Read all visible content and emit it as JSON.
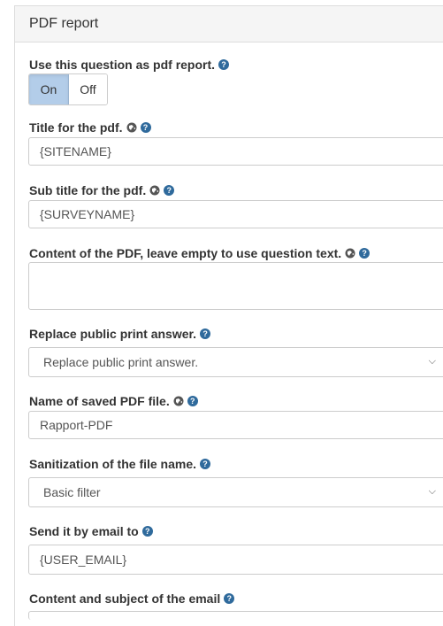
{
  "panel": {
    "title": "PDF report"
  },
  "pdf_report": {
    "label": "Use this question as pdf report.",
    "on_label": "On",
    "off_label": "Off",
    "selected": "On"
  },
  "title_pdf": {
    "label": "Title for the pdf.",
    "value": "{SITENAME}"
  },
  "subtitle_pdf": {
    "label": "Sub title for the pdf.",
    "value": "{SURVEYNAME}"
  },
  "content_pdf": {
    "label": "Content of the PDF, leave empty to use question text.",
    "value": ""
  },
  "replace_print": {
    "label": "Replace public print answer.",
    "selected": "Replace public print answer."
  },
  "file_name": {
    "label": "Name of saved PDF file.",
    "value": "Rapport-PDF"
  },
  "sanitization": {
    "label": "Sanitization of the file name.",
    "selected": "Basic filter"
  },
  "email_to": {
    "label": "Send it by email to",
    "value": "{USER_EMAIL}"
  },
  "email_content": {
    "label": "Content and subject of the email"
  },
  "icons": {
    "help": "question-circle-icon",
    "language": "globe-icon"
  },
  "colors": {
    "accent": "#2f6a9c",
    "toggle_active": "#b3cde9",
    "header_bg": "#f5f5f5"
  }
}
